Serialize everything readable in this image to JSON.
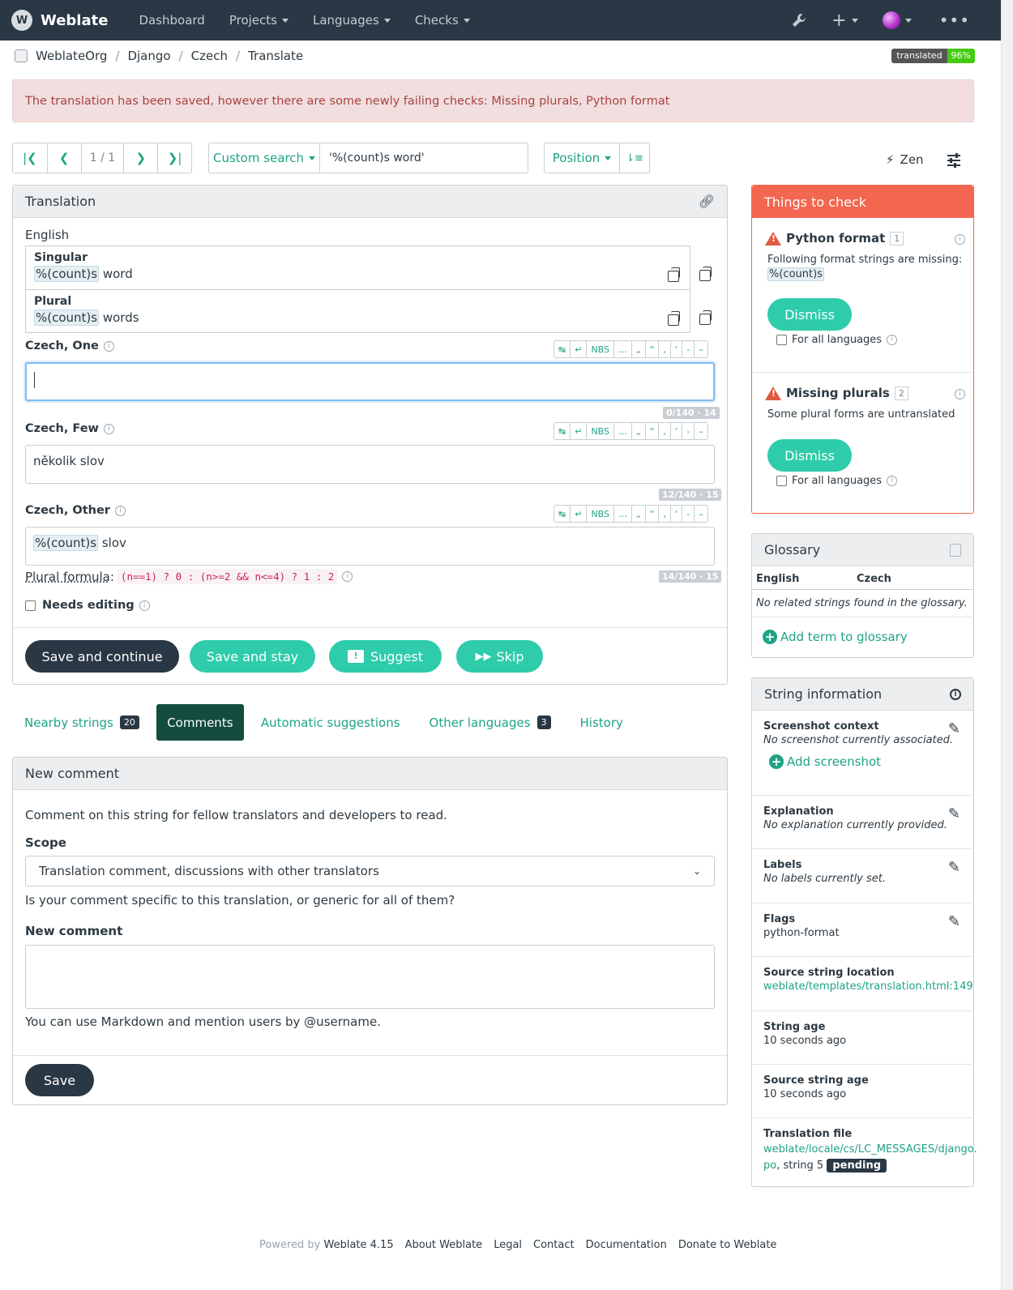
{
  "nav": {
    "brand": "Weblate",
    "items": [
      "Dashboard",
      "Projects",
      "Languages",
      "Checks"
    ]
  },
  "breadcrumb": [
    "WeblateOrg",
    "Django",
    "Czech",
    "Translate"
  ],
  "badge": {
    "label": "translated",
    "value": "96%"
  },
  "alert": "The translation has been saved, however there are some newly failing checks: Missing plurals, Python format",
  "pager": {
    "position": "1 / 1"
  },
  "search": {
    "mode": "Custom search",
    "query": "'%(count)s word'"
  },
  "sort": {
    "label": "Position"
  },
  "zen": "Zen",
  "translation": {
    "title": "Translation",
    "source_lang": "English",
    "source": [
      {
        "label": "Singular",
        "token": "%(count)s",
        "rest": " word"
      },
      {
        "label": "Plural",
        "token": "%(count)s",
        "rest": " words"
      }
    ],
    "forms": [
      {
        "label": "Czech, One",
        "value": "",
        "counter": "0/140 · 14"
      },
      {
        "label": "Czech, Few",
        "value": "několik slov",
        "counter": "12/140 · 15"
      },
      {
        "label": "Czech, Other",
        "token": "%(count)s",
        "rest": " slov",
        "counter": "14/140 · 15"
      }
    ],
    "keys": [
      "↹",
      "↵",
      "NBS",
      "…",
      "„",
      "“",
      ",",
      "‘",
      "-",
      "–"
    ],
    "plural_formula_label": "Plural formula",
    "plural_formula": "(n==1) ? 0 : (n>=2 && n<=4) ? 1 : 2",
    "needs_editing": "Needs editing",
    "buttons": {
      "save_continue": "Save and continue",
      "save_stay": "Save and stay",
      "suggest": "Suggest",
      "skip": "Skip"
    }
  },
  "tabs": [
    {
      "label": "Nearby strings",
      "count": "20"
    },
    {
      "label": "Comments"
    },
    {
      "label": "Automatic suggestions"
    },
    {
      "label": "Other languages",
      "count": "3"
    },
    {
      "label": "History"
    }
  ],
  "comment": {
    "title": "New comment",
    "intro": "Comment on this string for fellow translators and developers to read.",
    "scope_label": "Scope",
    "scope_value": "Translation comment, discussions with other translators",
    "scope_help": "Is your comment specific to this translation, or generic for all of them?",
    "new_comment_label": "New comment",
    "help": "You can use Markdown and mention users by @username.",
    "save": "Save"
  },
  "checks": {
    "title": "Things to check",
    "items": [
      {
        "name": "Python format",
        "count": "1",
        "desc": "Following format strings are missing:",
        "token": "%(count)s",
        "dismiss": "Dismiss",
        "all_langs": "For all languages"
      },
      {
        "name": "Missing plurals",
        "count": "2",
        "desc": "Some plural forms are untranslated",
        "dismiss": "Dismiss",
        "all_langs": "For all languages"
      }
    ]
  },
  "glossary": {
    "title": "Glossary",
    "col1": "English",
    "col2": "Czech",
    "empty": "No related strings found in the glossary.",
    "add": "Add term to glossary"
  },
  "string_info": {
    "title": "String information",
    "screenshot_title": "Screenshot context",
    "screenshot_value": "No screenshot currently associated.",
    "add_screenshot": "Add screenshot",
    "explanation_title": "Explanation",
    "explanation_value": "No explanation currently provided.",
    "labels_title": "Labels",
    "labels_value": "No labels currently set.",
    "flags_title": "Flags",
    "flags_value": "python-format",
    "location_title": "Source string location",
    "location_value": "weblate/templates/translation.html:149",
    "age_title": "String age",
    "age_value": "10 seconds ago",
    "source_age_title": "Source string age",
    "source_age_value": "10 seconds ago",
    "file_title": "Translation file",
    "file_link_1": "weblate/locale/cs/LC_MESSAGES/django.",
    "file_link_2": "po",
    "file_suffix": ", string 5",
    "file_badge": "pending"
  },
  "footer": {
    "powered": "Powered by",
    "version": "Weblate 4.15",
    "links": [
      "About Weblate",
      "Legal",
      "Contact",
      "Documentation",
      "Donate to Weblate"
    ]
  }
}
